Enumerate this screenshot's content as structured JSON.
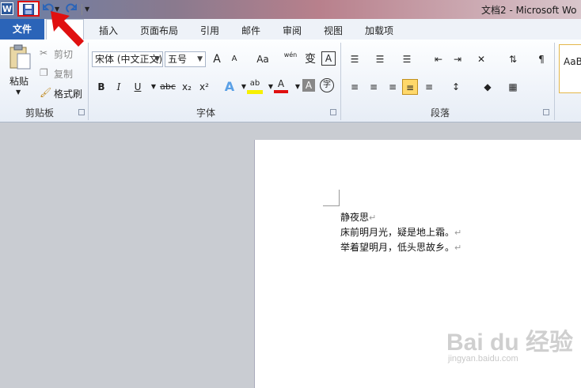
{
  "window": {
    "title": "文档2 - Microsoft Wo"
  },
  "app_icon_letter": "W",
  "tabs": {
    "file": "文件",
    "items": [
      "插入",
      "页面布局",
      "引用",
      "邮件",
      "审阅",
      "视图",
      "加载项"
    ]
  },
  "clipboard": {
    "paste": "粘贴",
    "cut": "剪切",
    "copy": "复制",
    "format_painter": "格式刷",
    "group": "剪贴板"
  },
  "font": {
    "family": "宋体 (中文正文)",
    "size": "五号",
    "grow": "A",
    "shrink": "A",
    "case": "Aa",
    "bold": "B",
    "italic": "I",
    "underline": "U",
    "strike": "abc",
    "sub": "x₂",
    "sup": "x²",
    "effects": "A",
    "highlight": "ab",
    "color": "A",
    "shade": "A",
    "enclose": "字",
    "phonetic": "wén",
    "phonetic_char": "变",
    "border": "A",
    "group": "字体"
  },
  "paragraph": {
    "group": "段落"
  },
  "styles": {
    "sample": "AaB"
  },
  "document": {
    "lines": [
      "静夜思",
      "床前明月光，疑是地上霜。",
      "举着望明月，低头思故乡。"
    ],
    "para_mark": "↵"
  },
  "watermark": {
    "big": "Bai du 经验",
    "small": "jingyan.baidu.com"
  },
  "colors": {
    "accent": "#2b64b8",
    "highlight_box": "#e01010",
    "arrow": "#e01010"
  }
}
